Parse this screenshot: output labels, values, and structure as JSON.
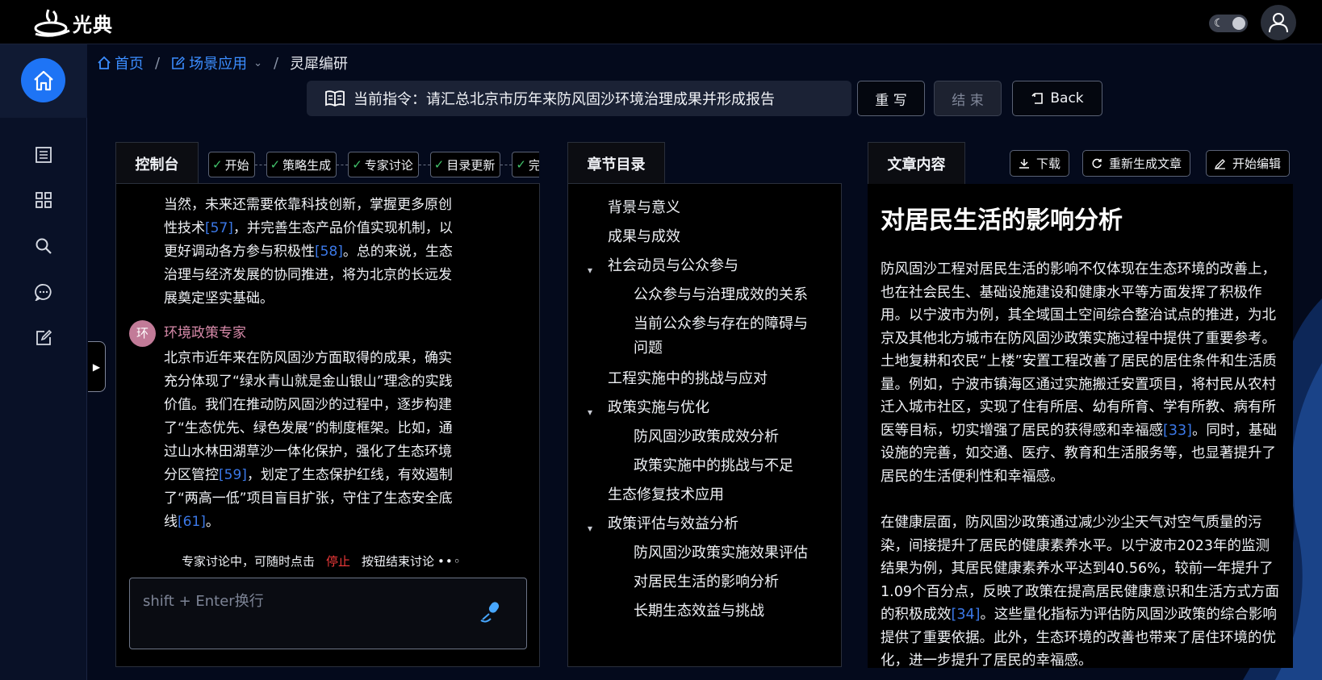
{
  "app": {
    "logo_text": "光典"
  },
  "breadcrumb": {
    "home": "首页",
    "scene": "场景应用",
    "current": "灵犀编研"
  },
  "instruction": {
    "label": "当前指令：",
    "text": "请汇总北京市历年来防风固沙环境治理成果并形成报告"
  },
  "buttons": {
    "rewrite": "重 写",
    "end": "结 束",
    "back": "Back"
  },
  "console": {
    "tab": "控制台",
    "steps": [
      "开始",
      "策略生成",
      "专家讨论",
      "目录更新",
      "完成"
    ],
    "msg1": [
      {
        "t": "当然，未来还需要依靠科技创新，掌握更多原创"
      },
      {
        "t": "性技术"
      },
      {
        "r": "[57]"
      },
      {
        "t": "，并完善生态产品价值实现机制，以"
      },
      {
        "t": "更好调动各方参与积极性"
      },
      {
        "r": "[58]"
      },
      {
        "t": "。总的来说，生态"
      },
      {
        "t": "治理与经济发展的协同推进，将为北京的长远发"
      },
      {
        "t": "展奠定坚实基础。"
      }
    ],
    "expert_avatar": "环",
    "expert_name": "环境政策专家",
    "msg2_lines": [
      "北京市近年来在防风固沙方面取得的成果，确实",
      "充分体现了“绿水青山就是金山银山”理念的实践",
      "价值。我们在推动防风固沙的过程中，逐步构建",
      "了“生态优先、绿色发展”的制度框架。比如，通",
      "过山水林田湖草沙一体化保护，强化了生态环境"
    ],
    "msg2_tail_a": "分区管控",
    "ref59": "[59]",
    "msg2_tail_b": "，划定了生态保护红线，有效遏制",
    "msg2_tail_c": "了“两高一低”项目盲目扩张，守住了生态安全底",
    "msg2_tail_d": "线",
    "ref61": "[61]",
    "msg2_tail_e": "。",
    "status_pre": "专家讨论中，可随时点击",
    "status_stop": "停止",
    "status_post": "按钮结束讨论",
    "input_placeholder": "shift + Enter换行"
  },
  "toc": {
    "tab": "章节目录",
    "items": [
      {
        "label": "背景与意义",
        "level": 1,
        "caret": false
      },
      {
        "label": "成果与成效",
        "level": 1,
        "caret": false
      },
      {
        "label": "社会动员与公众参与",
        "level": 1,
        "caret": true
      },
      {
        "label": "公众参与与治理成效的关系",
        "level": 2,
        "caret": false
      },
      {
        "label": "当前公众参与存在的障碍与",
        "level": 2,
        "caret": false
      },
      {
        "label": "问题",
        "level": 2,
        "caret": false
      },
      {
        "label": "工程实施中的挑战与应对",
        "level": 1,
        "caret": false
      },
      {
        "label": "政策实施与优化",
        "level": 1,
        "caret": true
      },
      {
        "label": "防风固沙政策成效分析",
        "level": 2,
        "caret": false
      },
      {
        "label": "政策实施中的挑战与不足",
        "level": 2,
        "caret": false
      },
      {
        "label": "生态修复技术应用",
        "level": 1,
        "caret": false
      },
      {
        "label": "政策评估与效益分析",
        "level": 1,
        "caret": true
      },
      {
        "label": "防风固沙政策实施效果评估",
        "level": 2,
        "caret": false
      },
      {
        "label": "对居民生活的影响分析",
        "level": 2,
        "caret": false
      },
      {
        "label": "长期生态效益与挑战",
        "level": 2,
        "caret": false
      }
    ]
  },
  "article": {
    "tab": "文章内容",
    "download": "下载",
    "regenerate": "重新生成文章",
    "edit": "开始编辑",
    "title": "对居民生活的影响分析",
    "p1a": "防风固沙工程对居民生活的影响不仅体现在生态环境的改善上，也在社会民生、基础设施建设和健康水平等方面发挥了积极作用。以宁波市为例，其全域国土空间综合整治试点的推进，为北京及其他北方城市在防风固沙政策实施过程中提供了重要参考。土地复耕和农民“上楼”安置工程改善了居民的居住条件和生活质量。例如，宁波市镇海区通过实施搬迁安置项目，将村民从农村迁入城市社区，实现了住有所居、幼有所育、学有所教、病有所医等目标，切实增强了居民的获得感和幸福感",
    "ref33": "[33]",
    "p1b": "。同时，基础设施的完善，如交通、医疗、教育和生活服务等，也显著提升了居民的生活便利性和幸福感。",
    "p2a": "在健康层面，防风固沙政策通过减少沙尘天气对空气质量的污染，间接提升了居民的健康素养水平。以宁波市2023年的监测结果为例，其居民健康素养水平达到40.56%，较前一年提升了1.09个百分点，反映了政策在提高居民健康意识和生活方式方面的积极成效",
    "ref34": "[34]",
    "p2b": "。这些量化指标为评估防风固沙政策的综合影响提供了重要依据。此外，生态环境的改善也带来了居住环境的优化，进一步提升了居民的幸福感。"
  },
  "colors": {
    "accent": "#1e74f5",
    "link": "#3b8dff",
    "ref": "#3b78e7",
    "stop": "#f03a3a",
    "check": "#42c46b",
    "expert": "#d78aa9"
  }
}
